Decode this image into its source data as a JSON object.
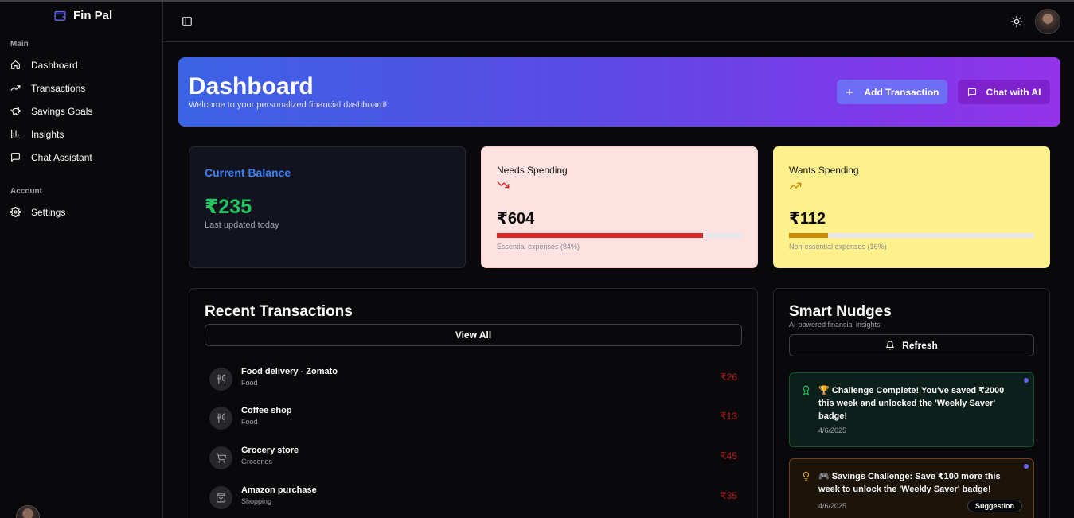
{
  "app": {
    "name": "Fin Pal"
  },
  "sidebar": {
    "main_label": "Main",
    "main_items": [
      {
        "label": "Dashboard",
        "icon": "home-icon"
      },
      {
        "label": "Transactions",
        "icon": "trending-up-icon"
      },
      {
        "label": "Savings Goals",
        "icon": "piggy-bank-icon"
      },
      {
        "label": "Insights",
        "icon": "bar-chart-icon"
      },
      {
        "label": "Chat Assistant",
        "icon": "message-square-icon"
      }
    ],
    "account_label": "Account",
    "account_items": [
      {
        "label": "Settings",
        "icon": "settings-icon"
      }
    ]
  },
  "hero": {
    "title": "Dashboard",
    "subtitle": "Welcome to your personalized financial dashboard!",
    "add_label": "Add Transaction",
    "chat_label": "Chat with AI"
  },
  "balance": {
    "title": "Current Balance",
    "value": "₹235",
    "subtitle": "Last updated today"
  },
  "needs": {
    "title": "Needs Spending",
    "value": "₹604",
    "percent": 84,
    "caption": "Essential expenses (84%)",
    "color": "#dc2626"
  },
  "wants": {
    "title": "Wants Spending",
    "value": "₹112",
    "percent": 16,
    "caption": "Non-essential expenses (16%)",
    "color": "#ca8a04"
  },
  "transactions": {
    "title": "Recent Transactions",
    "view_all": "View All",
    "items": [
      {
        "name": "Food delivery - Zomato",
        "category": "Food",
        "amount": "₹26",
        "icon": "utensils-icon"
      },
      {
        "name": "Coffee shop",
        "category": "Food",
        "amount": "₹13",
        "icon": "utensils-icon"
      },
      {
        "name": "Grocery store",
        "category": "Groceries",
        "amount": "₹45",
        "icon": "shopping-cart-icon"
      },
      {
        "name": "Amazon purchase",
        "category": "Shopping",
        "amount": "₹35",
        "icon": "shopping-bag-icon"
      }
    ]
  },
  "nudges": {
    "title": "Smart Nudges",
    "subtitle": "AI-powered financial insights",
    "refresh": "Refresh",
    "items": [
      {
        "text": "🏆 Challenge Complete! You've saved ₹2000 this week and unlocked the 'Weekly Saver' badge!",
        "date": "4/6/2025",
        "icon": "award-icon"
      },
      {
        "text": "🎮 Savings Challenge: Save ₹100 more this week to unlock the 'Weekly Saver' badge!",
        "date": "4/6/2025",
        "badge": "Suggestion",
        "icon": "lightbulb-icon"
      }
    ]
  }
}
